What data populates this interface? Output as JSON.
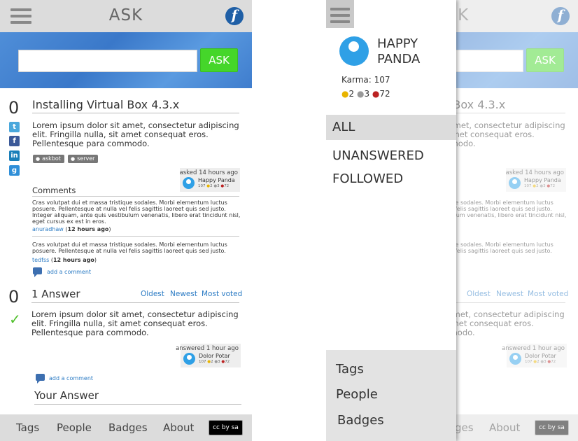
{
  "header": {
    "title": "ASK",
    "logo_glyph": "f"
  },
  "ask": {
    "button_label": "ASK",
    "input_placeholder": ""
  },
  "question": {
    "votes": "0",
    "title": "Installing Virtual Box 4.3.x",
    "body": "Lorem ipsum dolor sit amet, consectetur adipiscing elit. Fringilla nulla, sit amet consequat eros. Pellentesque para commodo.",
    "tags": [
      "askbot",
      "server"
    ],
    "asked": "asked 14 hours ago",
    "author": "Happy Panda",
    "author_karma": {
      "gold": "2",
      "silver": "3",
      "bronze": "72"
    }
  },
  "share_icons": [
    {
      "name": "twitter-icon",
      "glyph": "t",
      "color": "#4aa8dc"
    },
    {
      "name": "facebook-icon",
      "glyph": "f",
      "color": "#3b5998"
    },
    {
      "name": "linkedin-icon",
      "glyph": "in",
      "color": "#1a7fb9"
    },
    {
      "name": "googleplus-icon",
      "glyph": "g",
      "color": "#2f8fd8"
    }
  ],
  "comments": {
    "heading": "Comments",
    "items": [
      {
        "text": "Cras volutpat dui et massa tristique sodales. Morbi elementum luctus posuere. Pellentesque at nulla vel felis sagittis laoreet quis sed justo. Integer aliquam, ante quis vestibulum venenatis, libero erat tincidunt nisl, eget cursus ex est in eros.",
        "user": "anuradhaw",
        "time": "12 hours ago"
      },
      {
        "text": "Cras volutpat dui et massa tristique sodales. Morbi elementum luctus posuere. Pellentesque at nulla vel felis sagittis laoreet quis sed justo.",
        "user": "tedfss",
        "time": "12 hours ago"
      }
    ],
    "add_comment": "add a comment"
  },
  "answers": {
    "votes": "0",
    "heading": "1 Answer",
    "sort": [
      "Oldest",
      "Newest",
      "Most voted"
    ],
    "body": "Lorem ipsum dolor sit amet, consectetur adipiscing elit. Fringilla nulla, sit amet consequat eros. Pellentesque para commodo.",
    "answered": "answered 1 hour ago",
    "author": "Dolor Potar",
    "author_karma": {
      "gold": "2",
      "silver": "3",
      "bronze": "72"
    },
    "add_comment": "add a comment",
    "your_answer": "Your Answer"
  },
  "footer": {
    "links": [
      "Tags",
      "People",
      "Badges",
      "About"
    ],
    "license": "cc by sa"
  },
  "drawer": {
    "user_line1": "HAPPY",
    "user_line2": "PANDA",
    "karma": "Karma: 107",
    "badges": {
      "gold": "2",
      "silver": "3",
      "bronze": "72"
    },
    "filters": [
      "ALL",
      "UNANSWERED",
      "FOLLOWED"
    ],
    "bottom_links": [
      "Tags",
      "People",
      "Badges"
    ]
  },
  "colors": {
    "ask_button": "#45d62a",
    "band": "#3f7fcf",
    "link": "#2b7bc4",
    "accepted": "#4fbf2a"
  }
}
